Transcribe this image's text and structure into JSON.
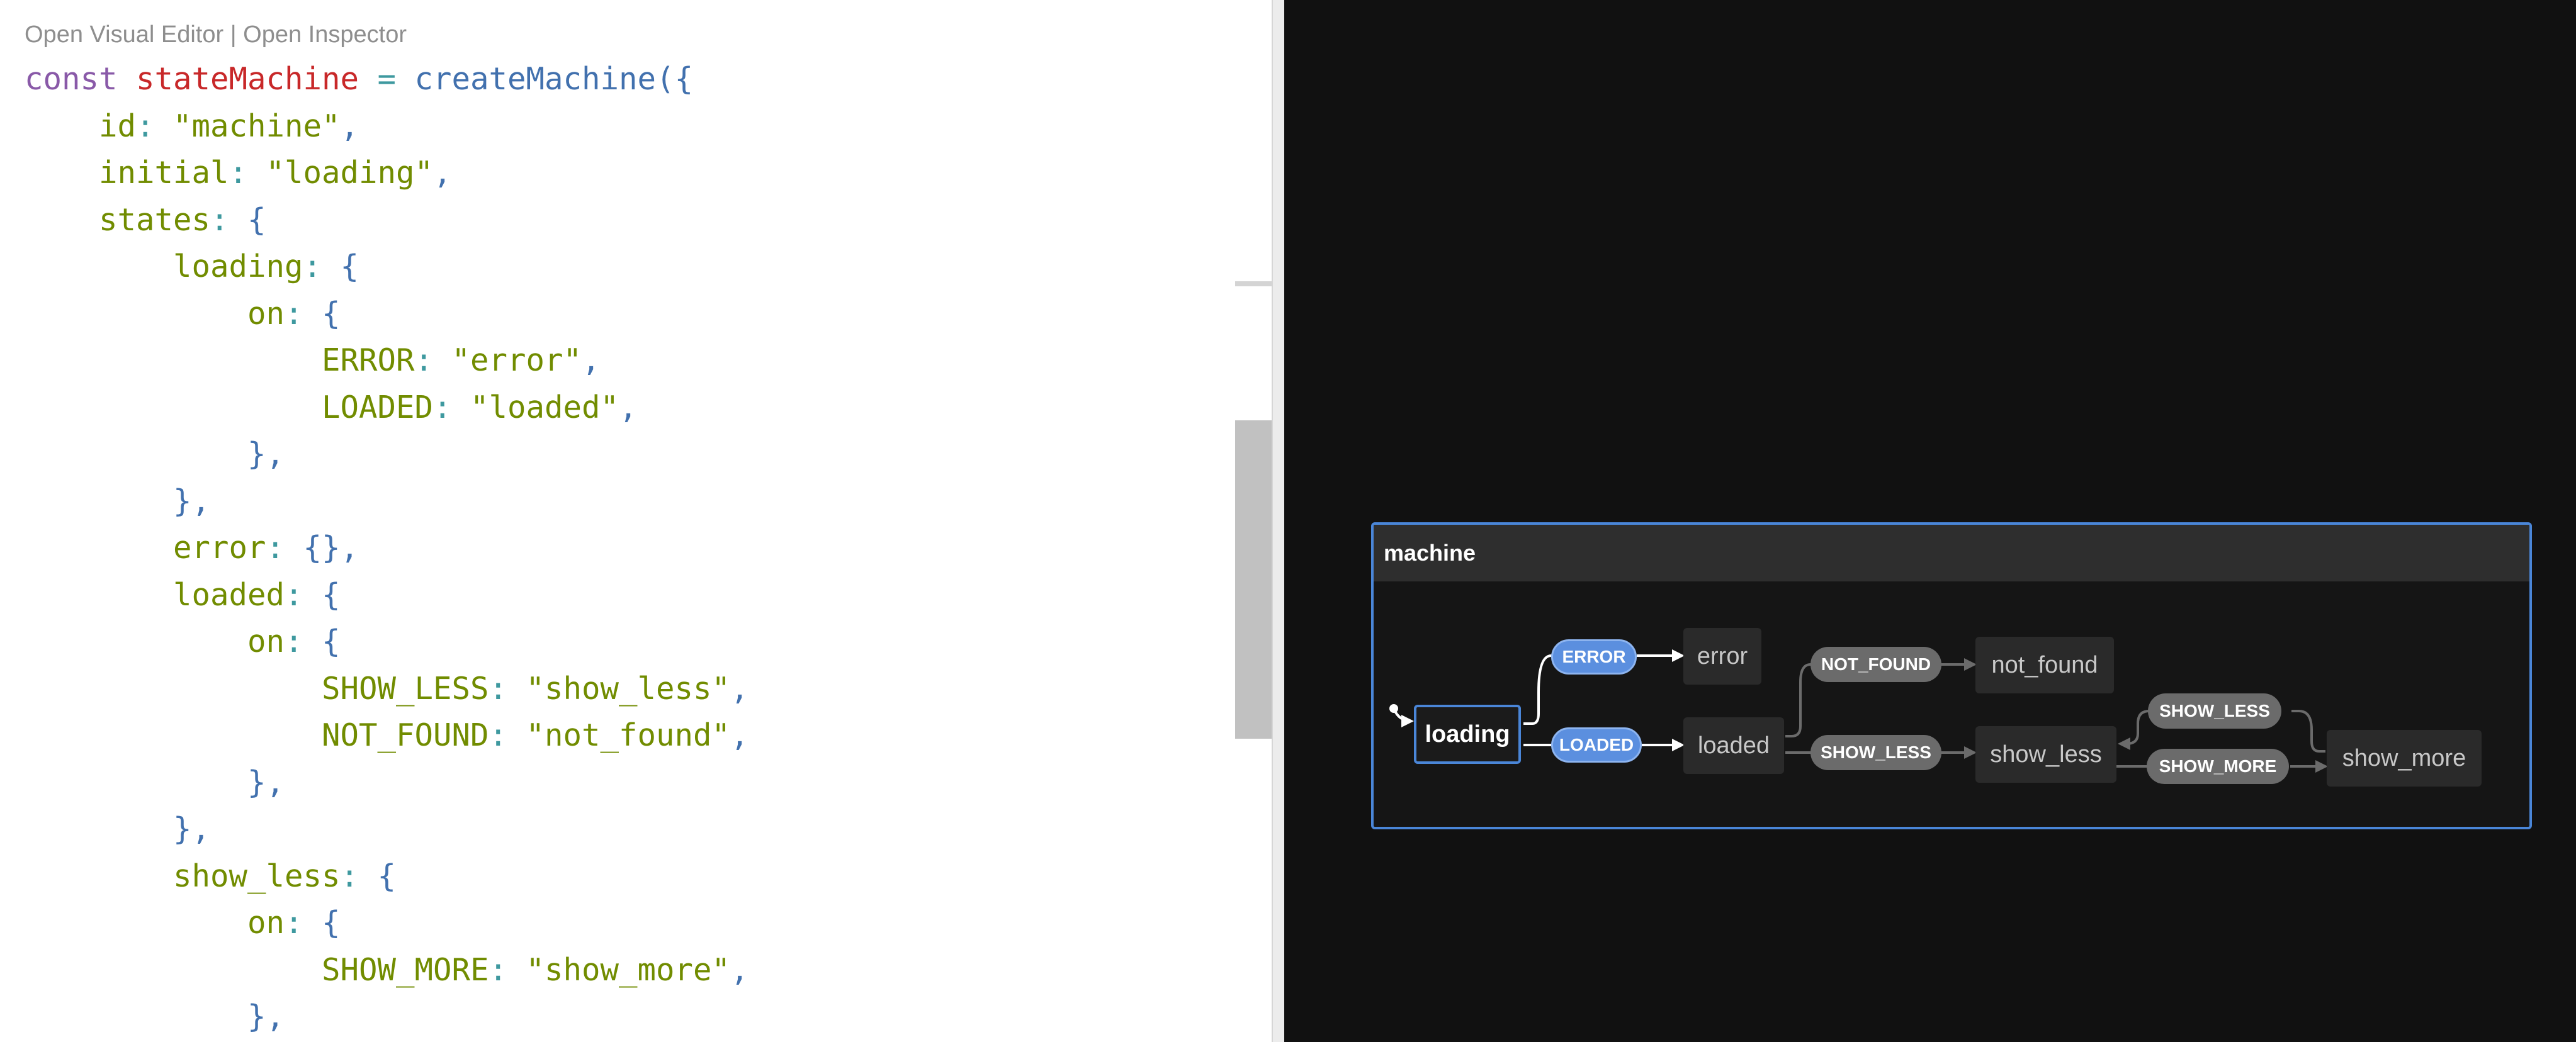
{
  "editor": {
    "links": {
      "visual_editor": "Open Visual Editor",
      "separator": " | ",
      "inspector": "Open Inspector"
    },
    "code_lines": [
      [
        {
          "t": "kw",
          "v": "const "
        },
        {
          "t": "var",
          "v": "stateMachine"
        },
        {
          "t": "p",
          "v": " = "
        },
        {
          "t": "fn",
          "v": "createMachine"
        },
        {
          "t": "b",
          "v": "({"
        }
      ],
      [
        {
          "t": "ws",
          "v": "    "
        },
        {
          "t": "key",
          "v": "id"
        },
        {
          "t": "p",
          "v": ": "
        },
        {
          "t": "str",
          "v": "\"machine\""
        },
        {
          "t": "b",
          "v": ","
        }
      ],
      [
        {
          "t": "ws",
          "v": "    "
        },
        {
          "t": "key",
          "v": "initial"
        },
        {
          "t": "p",
          "v": ": "
        },
        {
          "t": "str",
          "v": "\"loading\""
        },
        {
          "t": "b",
          "v": ","
        }
      ],
      [
        {
          "t": "ws",
          "v": "    "
        },
        {
          "t": "key",
          "v": "states"
        },
        {
          "t": "p",
          "v": ": "
        },
        {
          "t": "b",
          "v": "{"
        }
      ],
      [
        {
          "t": "ws",
          "v": "        "
        },
        {
          "t": "key",
          "v": "loading"
        },
        {
          "t": "p",
          "v": ": "
        },
        {
          "t": "b",
          "v": "{"
        }
      ],
      [
        {
          "t": "ws",
          "v": "            "
        },
        {
          "t": "key",
          "v": "on"
        },
        {
          "t": "p",
          "v": ": "
        },
        {
          "t": "b",
          "v": "{"
        }
      ],
      [
        {
          "t": "ws",
          "v": "                "
        },
        {
          "t": "key",
          "v": "ERROR"
        },
        {
          "t": "p",
          "v": ": "
        },
        {
          "t": "str",
          "v": "\"error\""
        },
        {
          "t": "b",
          "v": ","
        }
      ],
      [
        {
          "t": "ws",
          "v": "                "
        },
        {
          "t": "key",
          "v": "LOADED"
        },
        {
          "t": "p",
          "v": ": "
        },
        {
          "t": "str",
          "v": "\"loaded\""
        },
        {
          "t": "b",
          "v": ","
        }
      ],
      [
        {
          "t": "ws",
          "v": "            "
        },
        {
          "t": "b",
          "v": "},"
        }
      ],
      [
        {
          "t": "ws",
          "v": "        "
        },
        {
          "t": "b",
          "v": "},"
        }
      ],
      [
        {
          "t": "ws",
          "v": "        "
        },
        {
          "t": "key",
          "v": "error"
        },
        {
          "t": "p",
          "v": ": "
        },
        {
          "t": "b",
          "v": "{},"
        }
      ],
      [
        {
          "t": "ws",
          "v": "        "
        },
        {
          "t": "key",
          "v": "loaded"
        },
        {
          "t": "p",
          "v": ": "
        },
        {
          "t": "b",
          "v": "{"
        }
      ],
      [
        {
          "t": "ws",
          "v": "            "
        },
        {
          "t": "key",
          "v": "on"
        },
        {
          "t": "p",
          "v": ": "
        },
        {
          "t": "b",
          "v": "{"
        }
      ],
      [
        {
          "t": "ws",
          "v": "                "
        },
        {
          "t": "key",
          "v": "SHOW_LESS"
        },
        {
          "t": "p",
          "v": ": "
        },
        {
          "t": "str",
          "v": "\"show_less\""
        },
        {
          "t": "b",
          "v": ","
        }
      ],
      [
        {
          "t": "ws",
          "v": "                "
        },
        {
          "t": "key",
          "v": "NOT_FOUND"
        },
        {
          "t": "p",
          "v": ": "
        },
        {
          "t": "str",
          "v": "\"not_found\""
        },
        {
          "t": "b",
          "v": ","
        }
      ],
      [
        {
          "t": "ws",
          "v": "            "
        },
        {
          "t": "b",
          "v": "},"
        }
      ],
      [
        {
          "t": "ws",
          "v": "        "
        },
        {
          "t": "b",
          "v": "},"
        }
      ],
      [
        {
          "t": "ws",
          "v": "        "
        },
        {
          "t": "key",
          "v": "show_less"
        },
        {
          "t": "p",
          "v": ": "
        },
        {
          "t": "b",
          "v": "{"
        }
      ],
      [
        {
          "t": "ws",
          "v": "            "
        },
        {
          "t": "key",
          "v": "on"
        },
        {
          "t": "p",
          "v": ": "
        },
        {
          "t": "b",
          "v": "{"
        }
      ],
      [
        {
          "t": "ws",
          "v": "                "
        },
        {
          "t": "key",
          "v": "SHOW_MORE"
        },
        {
          "t": "p",
          "v": ": "
        },
        {
          "t": "str",
          "v": "\"show_more\""
        },
        {
          "t": "b",
          "v": ","
        }
      ],
      [
        {
          "t": "ws",
          "v": "            "
        },
        {
          "t": "b",
          "v": "},"
        }
      ]
    ]
  },
  "visualizer": {
    "machine_title": "machine",
    "states": {
      "loading": "loading",
      "error": "error",
      "loaded": "loaded",
      "not_found": "not_found",
      "show_less": "show_less",
      "show_more": "show_more"
    },
    "events": {
      "error": "ERROR",
      "loaded": "LOADED",
      "not_found": "NOT_FOUND",
      "show_less": "SHOW_LESS",
      "show_less_back": "SHOW_LESS",
      "show_more": "SHOW_MORE"
    }
  },
  "colors": {
    "accent": "#4a86d8",
    "event_enabled": "#5b8fdf",
    "event_disabled": "#6b6b6b",
    "viz_background": "#111111"
  }
}
